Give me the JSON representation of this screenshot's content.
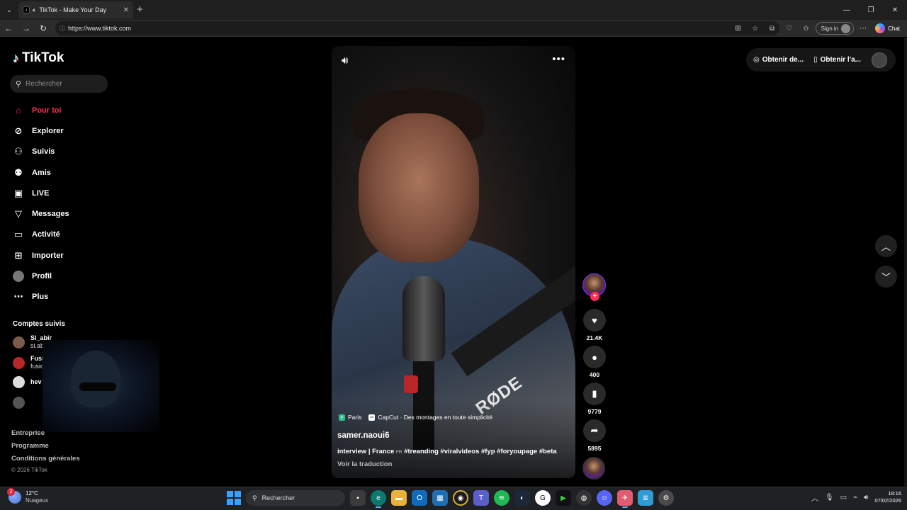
{
  "browser": {
    "tab_title": "TikTok - Make Your Day",
    "url": "https://www.tiktok.com",
    "signin_label": "Sign in",
    "chat_label": "Chat"
  },
  "tiktok": {
    "logo_text": "TikTok",
    "search_placeholder": "Rechercher",
    "menu": [
      {
        "label": "Pour toi",
        "icon": "home-icon"
      },
      {
        "label": "Explorer",
        "icon": "compass-icon"
      },
      {
        "label": "Suivis",
        "icon": "person-plus-icon"
      },
      {
        "label": "Amis",
        "icon": "people-icon"
      },
      {
        "label": "LIVE",
        "icon": "tv-icon"
      },
      {
        "label": "Messages",
        "icon": "send-icon"
      },
      {
        "label": "Activité",
        "icon": "bell-icon"
      },
      {
        "label": "Importer",
        "icon": "plus-square-icon"
      },
      {
        "label": "Profil",
        "icon": "avatar-icon"
      },
      {
        "label": "Plus",
        "icon": "more-icon"
      }
    ],
    "followed_title": "Comptes suivis",
    "followed": [
      {
        "name": "Sl_abir",
        "handle": "si.abiir.ff"
      },
      {
        "name": "Fusion",
        "handle": "fusion"
      },
      {
        "name": "hev",
        "handle": ""
      }
    ],
    "footer_links": [
      "Entreprise",
      "Programme",
      "Conditions générales"
    ],
    "copyright": "© 2026 TikTok",
    "top_right": {
      "get_coins": "Obtenir de...",
      "get_app": "Obtenir l'a..."
    }
  },
  "video": {
    "location": "Paris",
    "capcut": "CapCut · Des montages en toute simplicité",
    "author": "samer.naoui6",
    "desc_prefix": "interview | France",
    "desc_lang": "FR",
    "desc_tags": "#treanding #viralvideos #fyp #foryoupage #beta",
    "translate": "Voir la traduction",
    "mic_brand": "RØDE",
    "likes": "21.4K",
    "comments": "400",
    "saves": "9779",
    "shares": "5895"
  },
  "taskbar": {
    "weather_badge": "2",
    "temperature": "12°C",
    "condition": "Nuageux",
    "search": "Rechercher",
    "time": "18:16",
    "date": "07/02/2026"
  }
}
